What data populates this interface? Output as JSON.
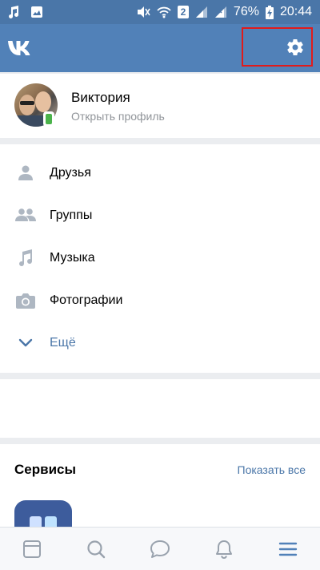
{
  "status_bar": {
    "battery_percent": "76%",
    "time": "20:44",
    "sim_label": "2"
  },
  "header": {
    "logo": "vk-logo",
    "settings_icon": "gear-icon"
  },
  "profile": {
    "name": "Виктория",
    "subtitle": "Открыть профиль"
  },
  "menu": {
    "items": [
      {
        "label": "Друзья",
        "icon": "person-icon"
      },
      {
        "label": "Группы",
        "icon": "people-icon"
      },
      {
        "label": "Музыка",
        "icon": "music-note-icon"
      },
      {
        "label": "Фотографии",
        "icon": "camera-icon"
      },
      {
        "label": "Ещё",
        "icon": "chevron-down-icon"
      }
    ]
  },
  "services": {
    "title": "Сервисы",
    "show_all": "Показать все"
  },
  "tabbar": {
    "tabs": [
      "news-icon",
      "search-icon",
      "messages-icon",
      "notifications-icon",
      "menu-icon"
    ],
    "active_tab": "menu-icon"
  },
  "colors": {
    "brand": "#5181b8",
    "accent_text": "#4a76a8",
    "highlight_border": "#e01b1b",
    "online": "#4bb34b"
  }
}
